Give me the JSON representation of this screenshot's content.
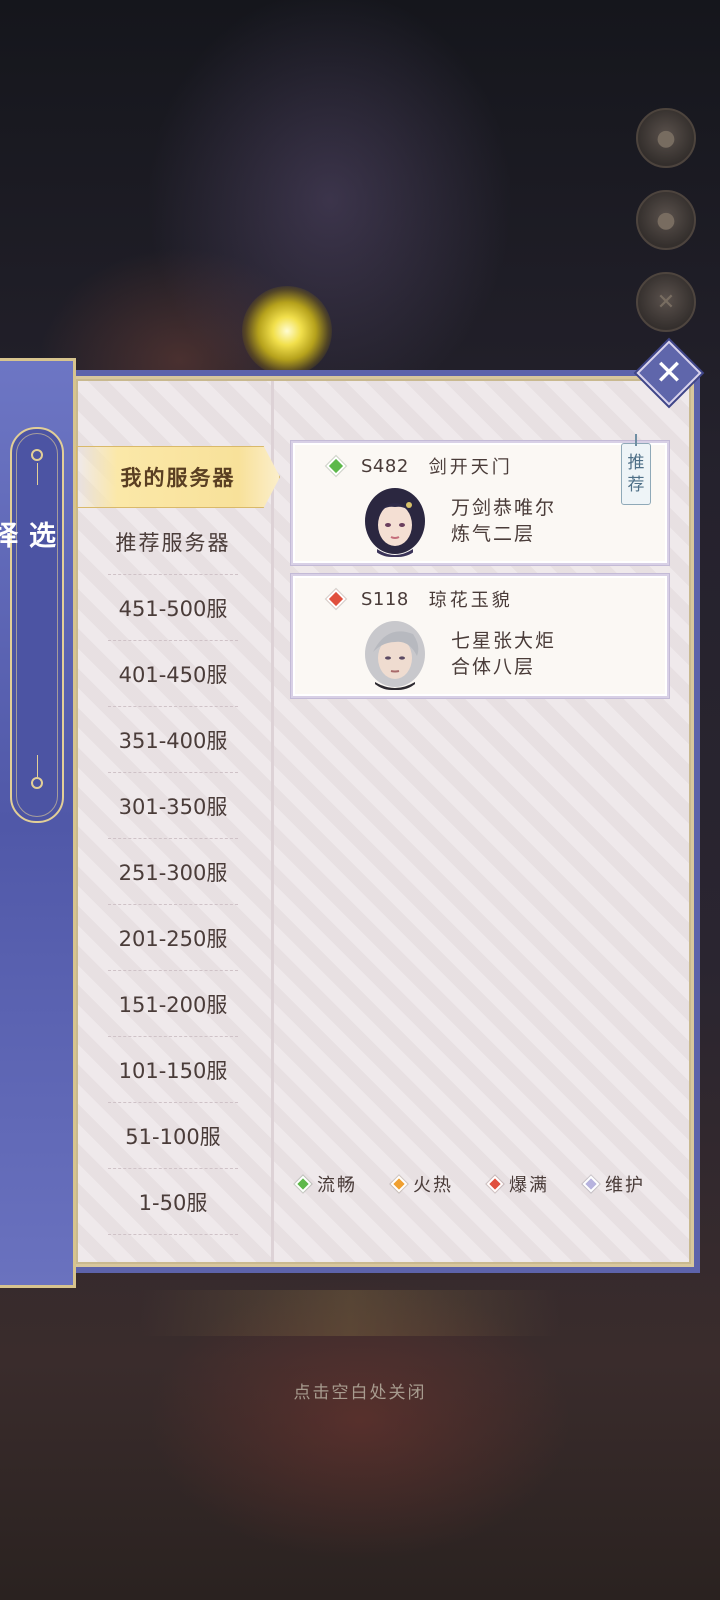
{
  "panel": {
    "title": "选择服务器",
    "close_label": "✕"
  },
  "nav": {
    "items": [
      {
        "label": "我的服务器",
        "active": true
      },
      {
        "label": "推荐服务器"
      },
      {
        "label": "451-500服"
      },
      {
        "label": "401-450服"
      },
      {
        "label": "351-400服"
      },
      {
        "label": "301-350服"
      },
      {
        "label": "251-300服"
      },
      {
        "label": "201-250服"
      },
      {
        "label": "151-200服"
      },
      {
        "label": "101-150服"
      },
      {
        "label": "51-100服"
      },
      {
        "label": "1-50服"
      }
    ]
  },
  "servers": [
    {
      "status_color": "#5db84a",
      "id": "S482",
      "name": "剑开天门",
      "character": "万剑恭唯尔",
      "level": "炼气二层",
      "tag": "推荐",
      "avatar_icon": "female-character-avatar"
    },
    {
      "status_color": "#e0503e",
      "id": "S118",
      "name": "琼花玉貌",
      "character": "七星张大炬",
      "level": "合体八层",
      "avatar_icon": "male-character-avatar"
    }
  ],
  "legend": [
    {
      "label": "流畅",
      "color": "#5db84a"
    },
    {
      "label": "火热",
      "color": "#f0a030"
    },
    {
      "label": "爆满",
      "color": "#e0503e"
    },
    {
      "label": "维护",
      "color": "#b7b3de"
    }
  ],
  "hint": "点击空白处关闭"
}
